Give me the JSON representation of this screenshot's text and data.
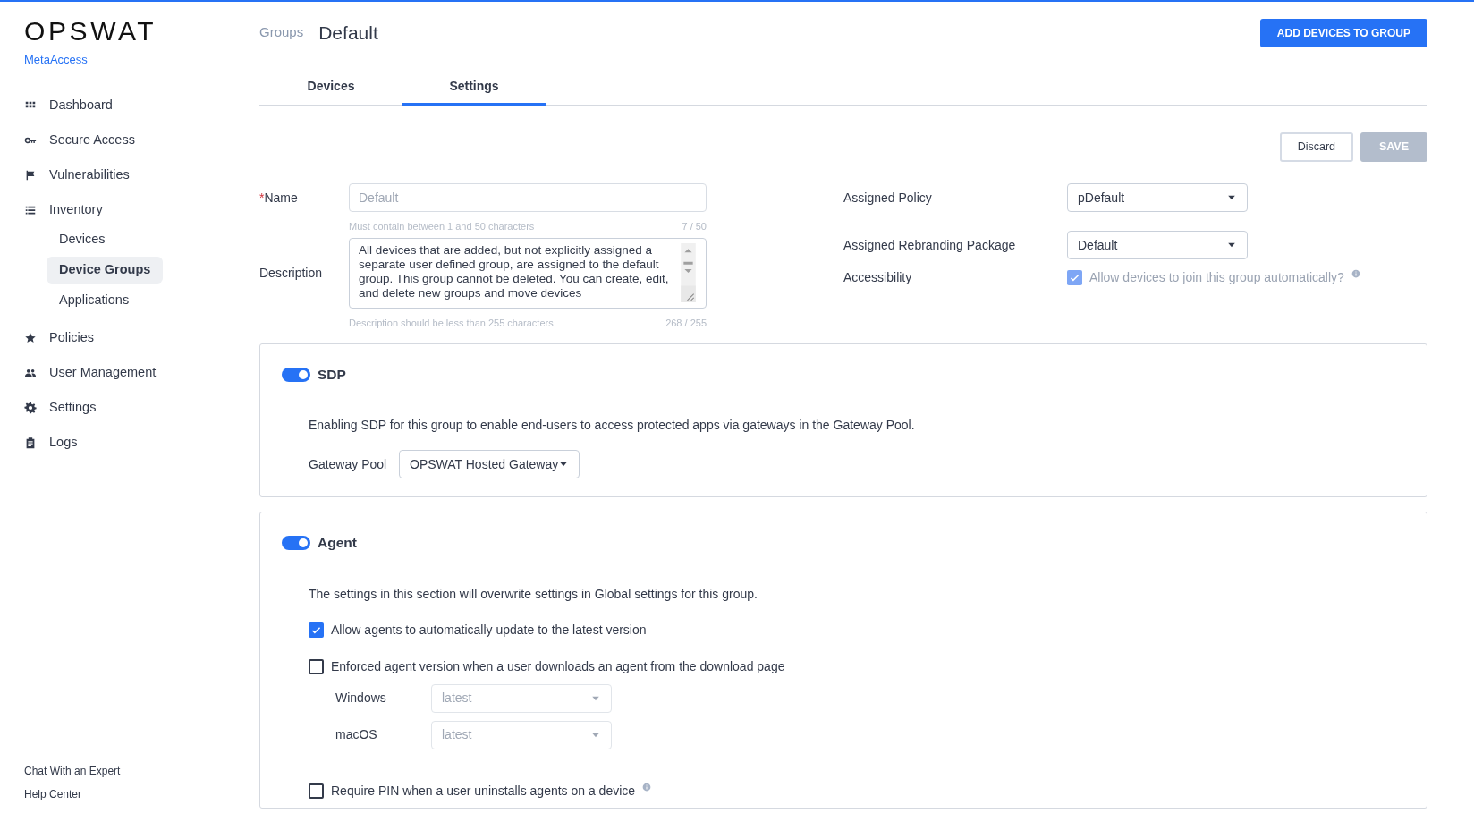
{
  "logo": {
    "wordmark": "OPSWAT",
    "product": "MetaAccess"
  },
  "sidebar": {
    "items": [
      {
        "label": "Dashboard",
        "selected": false
      },
      {
        "label": "Secure Access",
        "selected": false
      },
      {
        "label": "Vulnerabilities",
        "selected": false
      },
      {
        "label": "Inventory",
        "selected": false,
        "children": [
          {
            "label": "Devices",
            "selected": false
          },
          {
            "label": "Device Groups",
            "selected": true
          },
          {
            "label": "Applications",
            "selected": false
          }
        ]
      },
      {
        "label": "Policies",
        "selected": false
      },
      {
        "label": "User Management",
        "selected": false
      },
      {
        "label": "Settings",
        "selected": false
      },
      {
        "label": "Logs",
        "selected": false
      }
    ],
    "footer_links": [
      "Chat With an Expert",
      "Help Center"
    ]
  },
  "header": {
    "breadcrumb": "Groups",
    "title": "Default",
    "action": "ADD DEVICES TO GROUP"
  },
  "tabs": [
    {
      "label": "Devices",
      "selected": false
    },
    {
      "label": "Settings",
      "selected": true
    }
  ],
  "actions": [
    {
      "label": "Discard",
      "disabled": false
    },
    {
      "label": "SAVE",
      "disabled": true
    }
  ],
  "form": {
    "name": {
      "required_mark": "*",
      "label": "Name",
      "placeholder": "Default",
      "hint": "Must contain between 1 and 50 characters",
      "count": "7 / 50"
    },
    "description": {
      "label": "Description",
      "value": "All devices that are added, but not explicitly assigned a separate user defined group, are assigned to the default group. This group cannot be deleted. You can create, edit, and delete new groups and move devices",
      "hint": "Description should be less than 255 characters",
      "count": "268 / 255"
    },
    "right": [
      {
        "kind": "select",
        "label": "Assigned Policy",
        "value": "pDefault"
      },
      {
        "kind": "select",
        "label": "Assigned Rebranding Package",
        "value": "Default"
      },
      {
        "kind": "checkbox",
        "label": "Accessibility",
        "text": "Allow devices to join this group automatically?",
        "checked": true,
        "disabled": true,
        "info": true
      }
    ]
  },
  "sections": [
    {
      "title": "SDP",
      "on": true,
      "description": "Enabling SDP for this group to enable end-users to access protected apps via gateways in the Gateway Pool.",
      "rows": [
        {
          "kind": "select",
          "label": "Gateway Pool",
          "value": "OPSWAT Hosted Gateway",
          "disabled": false
        }
      ]
    },
    {
      "title": "Agent",
      "on": true,
      "description": "The settings in this section will overwrite settings in Global settings for this group.",
      "rows": [
        {
          "kind": "checkbox",
          "text": "Allow agents to automatically update to the latest version",
          "checked": true,
          "info": false
        },
        {
          "kind": "checkbox",
          "text": "Enforced agent version when a user downloads an agent from the download page",
          "checked": false,
          "info": false,
          "children": [
            {
              "label": "Windows",
              "value": "latest",
              "disabled": true
            },
            {
              "label": "macOS",
              "value": "latest",
              "disabled": true
            }
          ]
        },
        {
          "kind": "checkbox",
          "text": "Require PIN when a user uninstalls agents on a device",
          "checked": false,
          "info": true
        }
      ]
    }
  ]
}
